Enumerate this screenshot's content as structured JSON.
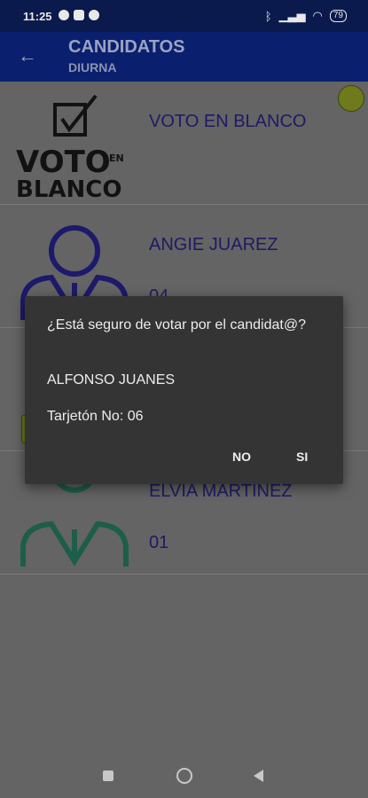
{
  "status_bar": {
    "time": "11:25",
    "battery": "79"
  },
  "app_bar": {
    "title": "CANDIDATOS",
    "subtitle": "DIURNA"
  },
  "candidates": [
    {
      "name": "VOTO EN BLANCO",
      "number": "",
      "logo_text_top": "VOTO",
      "logo_text_small": "EN",
      "logo_text_bottom": "BLANCO"
    },
    {
      "name": "ANGIE JUAREZ",
      "number": "04"
    },
    {
      "name": "",
      "number": ""
    },
    {
      "name": "ELVIA MARTINEZ",
      "number": "01"
    }
  ],
  "dialog": {
    "message": "¿Está seguro de votar por el candidat@?",
    "candidate": "ALFONSO JUANES",
    "tarjeton": "Tarjetón No: 06",
    "no_label": "NO",
    "si_label": "SI"
  },
  "colors": {
    "app_bar": "#0a1f6e",
    "status_bar": "#0a1a4d",
    "overlay": "#646464",
    "dialog": "#343434",
    "candidate_text": "#1e1a66"
  }
}
